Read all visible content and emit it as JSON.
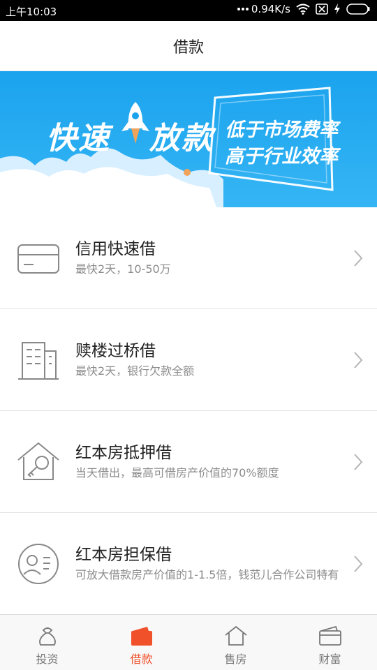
{
  "status_bar": {
    "time": "上午10:03",
    "network_speed": "0.94K/s",
    "icons": [
      "more-dots-icon",
      "wifi-icon",
      "no-sim-icon",
      "charging-icon",
      "battery-icon"
    ]
  },
  "header": {
    "title": "借款"
  },
  "banner": {
    "title_left": "快速",
    "title_right": "放款",
    "slogan_line1": "低于市场费率",
    "slogan_line2": "高于行业效率",
    "colors": {
      "sky": "#1ba3ee",
      "cloud": "#ffffff"
    }
  },
  "loans": [
    {
      "icon": "credit-card-icon",
      "title": "信用快速借",
      "desc": "最快2天，10-50万"
    },
    {
      "icon": "building-icon",
      "title": "赎楼过桥借",
      "desc": "最快2天，银行欠款全额"
    },
    {
      "icon": "house-key-icon",
      "title": "红本房抵押借",
      "desc": "当天借出，最高可借房产价值的70%额度"
    },
    {
      "icon": "user-card-icon",
      "title": "红本房担保借",
      "desc": "可放大借款房产价值的1-1.5倍，钱范儿合作公司特有"
    }
  ],
  "tabs": [
    {
      "icon": "money-bag-icon",
      "label": "投资",
      "active": false
    },
    {
      "icon": "wallet-icon",
      "label": "借款",
      "active": true
    },
    {
      "icon": "house-icon",
      "label": "售房",
      "active": false
    },
    {
      "icon": "purse-icon",
      "label": "财富",
      "active": false
    }
  ],
  "colors": {
    "accent": "#f0512a",
    "text_secondary": "#8c8c8c",
    "divider": "#e2e2e2"
  }
}
